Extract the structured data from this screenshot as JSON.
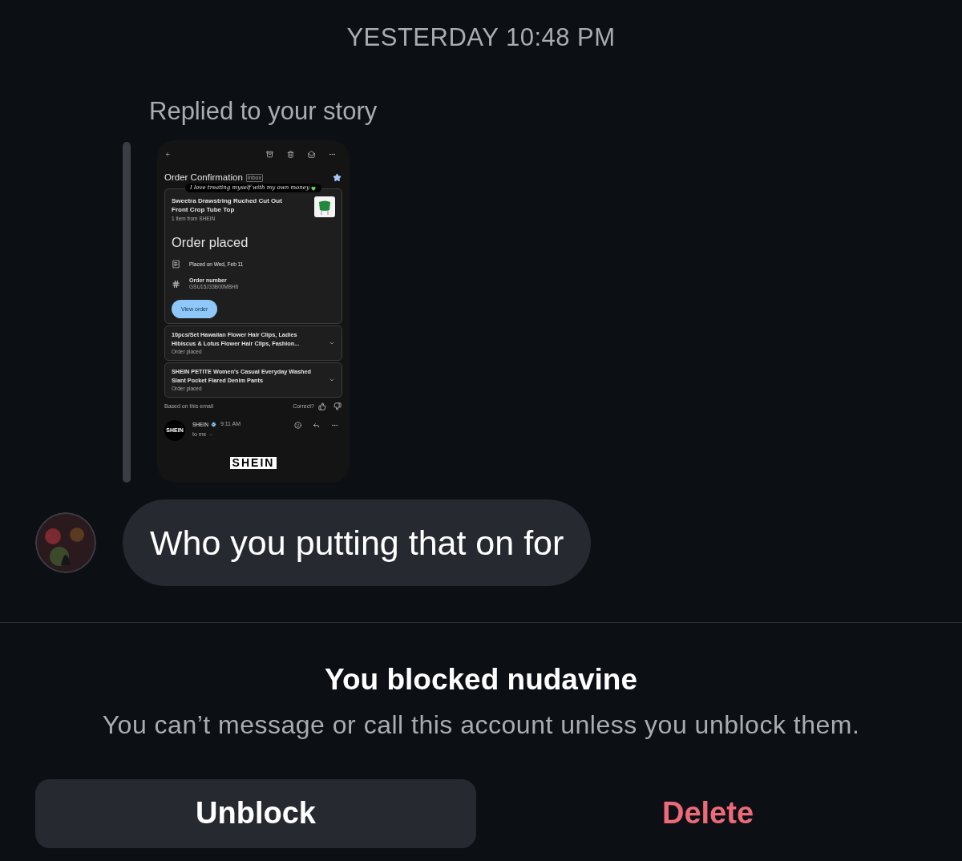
{
  "timestamp": "YESTERDAY 10:48 PM",
  "reply_label": "Replied to your story",
  "story": {
    "subject": "Order Confirmation",
    "label": "Inbox",
    "starred": true,
    "caption": "I love treating myself with my own money",
    "order": {
      "title": "Sweetra Drawstring Ruched Cut Out Front Crop Tube Top",
      "subtitle": "1 item from SHEIN",
      "status": "Order placed",
      "placed": "Placed on Wed, Feb 11",
      "number_label": "Order number",
      "number": "GSU15J33B00MBH6",
      "button": "View order"
    },
    "items": [
      {
        "title": "10pcs/Set Hawaiian Flower Hair Clips, Ladies Hibiscus & Lotus Flower Hair Clips, Fashion...",
        "status": "Order placed"
      },
      {
        "title": "SHEIN PETITE Women's Casual Everyday Washed Slant Pocket Flared Denim Pants",
        "status": "Order placed"
      }
    ],
    "feedback": {
      "note": "Based on this email",
      "question": "Correct?"
    },
    "sender": {
      "avatar": "SHEIN",
      "name": "SHEIN",
      "time": "9:11 AM",
      "to": "to me"
    },
    "logo": "SHEIN"
  },
  "message": "Who you putting that on for",
  "blocked": {
    "title": "You blocked nudavine",
    "text": "You can’t message or call this account unless you unblock them."
  },
  "buttons": [
    {
      "label": "Unblock",
      "kind": "primary"
    },
    {
      "label": "Delete",
      "kind": "destructive"
    }
  ]
}
